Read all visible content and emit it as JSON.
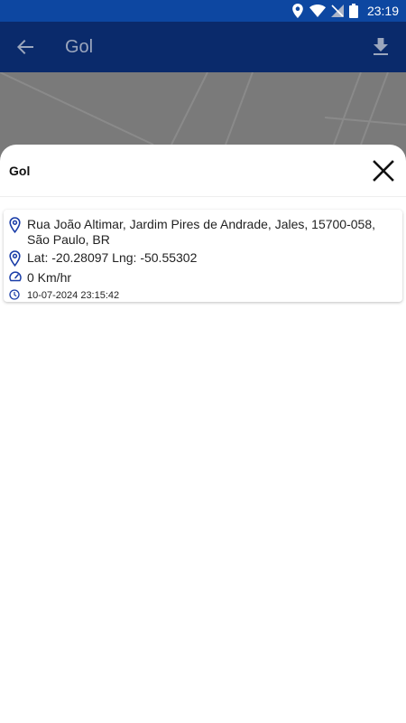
{
  "status_bar": {
    "time": "23:19",
    "icons": [
      "location-icon",
      "wifi-icon",
      "no-signal-icon",
      "battery-icon"
    ]
  },
  "app_bar": {
    "title": "Gol",
    "back_icon": "arrow-back-icon",
    "download_icon": "download-icon"
  },
  "sheet": {
    "title": "Gol",
    "close_icon": "close-icon",
    "card": {
      "address": "Rua João Altimar, Jardim Pires de Andrade, Jales, 15700-058, São Paulo, BR",
      "latlng": "Lat: -20.28097 Lng: -50.55302",
      "speed": "0 Km/hr",
      "timestamp": "10-07-2024 23:15:42"
    }
  },
  "colors": {
    "status_bar": "#0d47a1",
    "app_bar": "#0a2a6b",
    "icon_blue": "#1a3da8",
    "map": "#7a7a7a"
  }
}
